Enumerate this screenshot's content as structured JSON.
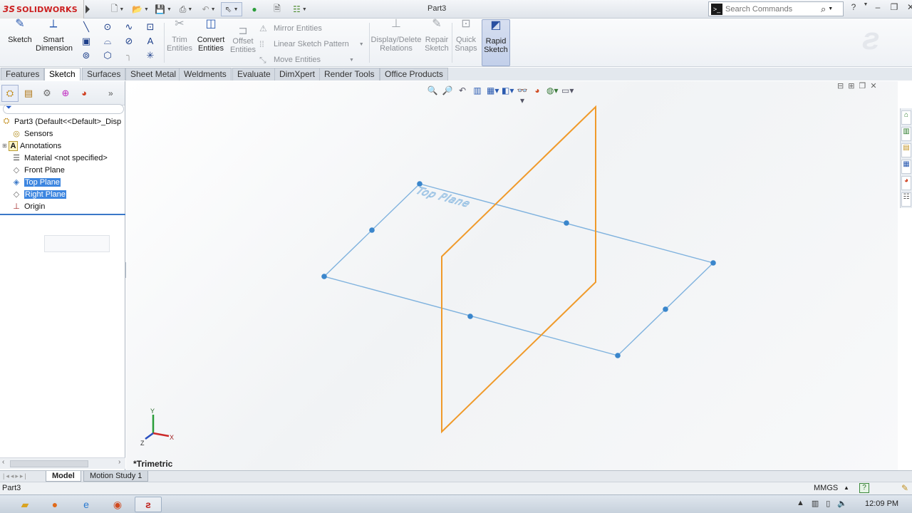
{
  "app": {
    "brand_ds": "3S",
    "brand_name": "SOLIDWORKS",
    "document_title": "Part3"
  },
  "search": {
    "placeholder": "Search Commands"
  },
  "command_manager": {
    "sketch": "Sketch",
    "smart_dimension_1": "Smart",
    "smart_dimension_2": "Dimension",
    "trim_1": "Trim",
    "trim_2": "Entities",
    "convert_1": "Convert",
    "convert_2": "Entities",
    "offset_1": "Offset",
    "offset_2": "Entities",
    "mirror": "Mirror Entities",
    "linear_pattern": "Linear Sketch Pattern",
    "move": "Move Entities",
    "display_delete_1": "Display/Delete",
    "display_delete_2": "Relations",
    "repair_1": "Repair",
    "repair_2": "Sketch",
    "quick_snaps_1": "Quick",
    "quick_snaps_2": "Snaps",
    "rapid_1": "Rapid",
    "rapid_2": "Sketch"
  },
  "tabs": [
    {
      "label": "Features"
    },
    {
      "label": "Sketch"
    },
    {
      "label": "Surfaces"
    },
    {
      "label": "Sheet Metal"
    },
    {
      "label": "Weldments"
    },
    {
      "label": "Evaluate"
    },
    {
      "label": "DimXpert"
    },
    {
      "label": "Render Tools"
    },
    {
      "label": "Office Products"
    }
  ],
  "tree": {
    "root": "Part3  (Default<<Default>_Disp",
    "sensors": "Sensors",
    "annotations": "Annotations",
    "material": "Material <not specified>",
    "front_plane": "Front Plane",
    "top_plane": "Top Plane",
    "right_plane": "Right Plane",
    "origin": "Origin"
  },
  "graphics": {
    "plane_text": "Top Plane",
    "view_label": "*Trimetric",
    "axis_x": "X",
    "axis_y": "Y",
    "axis_z": "Z",
    "colors": {
      "top_plane": "#7fb2de",
      "right_plane": "#f09a2a",
      "handle": "#3a86cc"
    }
  },
  "bottom_tabs": [
    {
      "label": "Model"
    },
    {
      "label": "Motion Study 1"
    }
  ],
  "status": {
    "left": "Part3",
    "units": "MMGS"
  },
  "taskbar": {
    "clock": "12:09 PM"
  }
}
